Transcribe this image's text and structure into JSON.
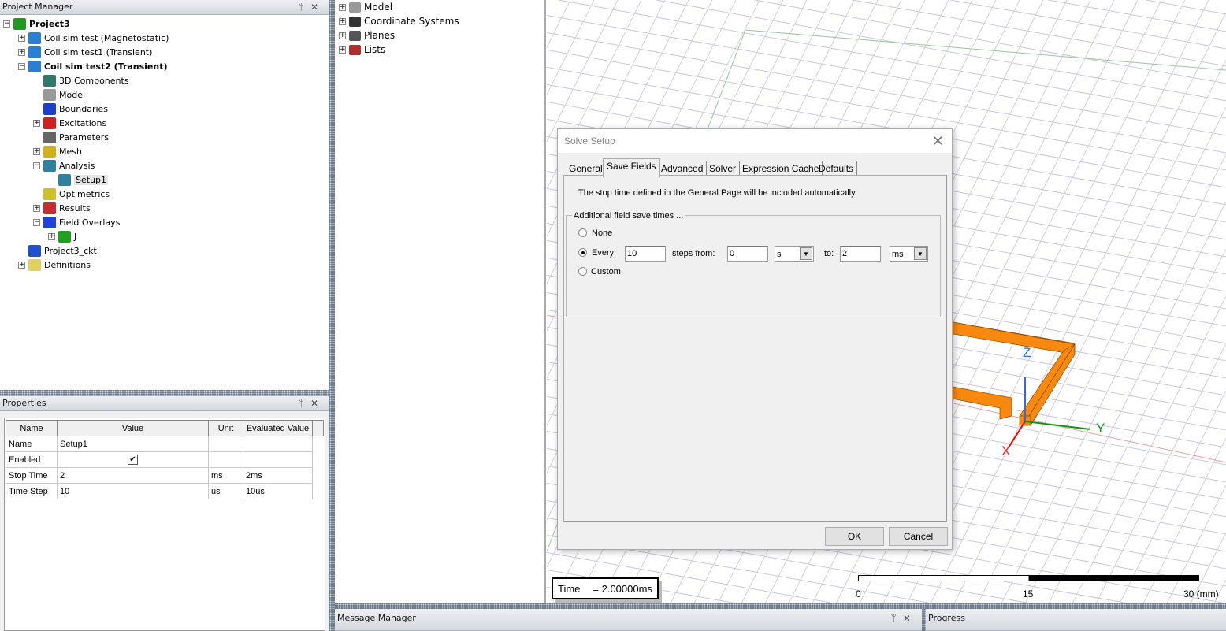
{
  "project_manager": {
    "title": "Project Manager",
    "tree": [
      {
        "label": "Project3",
        "level": 0,
        "toggle": "-",
        "bold": true,
        "icon": "project-icon",
        "color": "#1f9a1f"
      },
      {
        "label": "Coil sim test (Magnetostatic)",
        "level": 1,
        "toggle": "+",
        "icon": "maxwell-design-icon",
        "color": "#2a7fd0"
      },
      {
        "label": "Coil sim test1 (Transient)",
        "level": 1,
        "toggle": "+",
        "icon": "maxwell-design-icon",
        "color": "#2a7fd0"
      },
      {
        "label": "Coil sim test2 (Transient)",
        "level": 1,
        "toggle": "-",
        "bold": true,
        "icon": "maxwell-design-icon",
        "color": "#2a7fd0"
      },
      {
        "label": "3D Components",
        "level": 2,
        "icon": "3d-components-icon",
        "color": "#2d7a6a"
      },
      {
        "label": "Model",
        "level": 2,
        "icon": "model-icon",
        "color": "#999999"
      },
      {
        "label": "Boundaries",
        "level": 2,
        "icon": "boundaries-icon",
        "color": "#1a3fd0"
      },
      {
        "label": "Excitations",
        "level": 2,
        "toggle": "+",
        "icon": "excitations-icon",
        "color": "#d02020"
      },
      {
        "label": "Parameters",
        "level": 2,
        "icon": "parameters-icon",
        "color": "#666666"
      },
      {
        "label": "Mesh",
        "level": 2,
        "toggle": "+",
        "icon": "mesh-icon",
        "color": "#d0b020"
      },
      {
        "label": "Analysis",
        "level": 2,
        "toggle": "-",
        "icon": "analysis-icon",
        "color": "#3080a0"
      },
      {
        "label": "Setup1",
        "level": 3,
        "selected": true,
        "icon": "setup-icon",
        "color": "#3080a0"
      },
      {
        "label": "Optimetrics",
        "level": 2,
        "icon": "optimetrics-icon",
        "color": "#d0c020"
      },
      {
        "label": "Results",
        "level": 2,
        "toggle": "+",
        "icon": "results-icon",
        "color": "#c03030"
      },
      {
        "label": "Field Overlays",
        "level": 2,
        "toggle": "-",
        "icon": "field-overlays-icon",
        "color": "#2040e0"
      },
      {
        "label": "J",
        "level": 3,
        "toggle": "+",
        "icon": "field-plot-icon",
        "color": "#20a020"
      },
      {
        "label": "Project3_ckt",
        "level": 1,
        "icon": "circuit-icon",
        "color": "#2050d0"
      },
      {
        "label": "Definitions",
        "level": 1,
        "toggle": "+",
        "icon": "folder-icon",
        "color": "#e0d060"
      }
    ]
  },
  "properties": {
    "title": "Properties",
    "columns": [
      "Name",
      "Value",
      "Unit",
      "Evaluated Value"
    ],
    "rows": [
      [
        "Name",
        "Setup1",
        "",
        ""
      ],
      [
        "Enabled",
        "✔",
        "",
        ""
      ],
      [
        "Stop Time",
        "2",
        "ms",
        "2ms"
      ],
      [
        "Time Step",
        "10",
        "us",
        "10us"
      ]
    ]
  },
  "model_tree": [
    {
      "label": "Model",
      "icon": "model-icon"
    },
    {
      "label": "Coordinate Systems",
      "icon": "coordinate-systems-icon"
    },
    {
      "label": "Planes",
      "icon": "planes-icon"
    },
    {
      "label": "Lists",
      "icon": "lists-icon"
    }
  ],
  "dialog": {
    "title": "Solve Setup",
    "tabs": [
      "General",
      "Save Fields",
      "Advanced",
      "Solver",
      "Expression Cache",
      "Defaults"
    ],
    "active_tab": "Save Fields",
    "info": "The stop time defined in the General Page will be included automatically.",
    "group_label": "Additional field save times ...",
    "options": {
      "none": "None",
      "every": "Every",
      "custom": "Custom"
    },
    "selected_option": "Every",
    "every_value": "10",
    "steps_from_label": "steps from:",
    "from_value": "0",
    "from_unit": "s",
    "to_label": "to:",
    "to_value": "2",
    "to_unit": "ms",
    "ok": "OK",
    "cancel": "Cancel"
  },
  "viewport": {
    "time_label": "Time",
    "time_value": "=  2.00000ms",
    "axes": {
      "x": "X",
      "y": "Y",
      "z": "Z"
    },
    "scale": {
      "ticks": [
        "0",
        "15",
        "30 (mm)"
      ]
    },
    "colors": {
      "coil": "#f7890f",
      "x_axis": "#ff0000",
      "y_axis": "#119911",
      "z_axis": "#3366ee"
    }
  },
  "bottom": {
    "message_manager": "Message Manager",
    "progress": "Progress"
  }
}
